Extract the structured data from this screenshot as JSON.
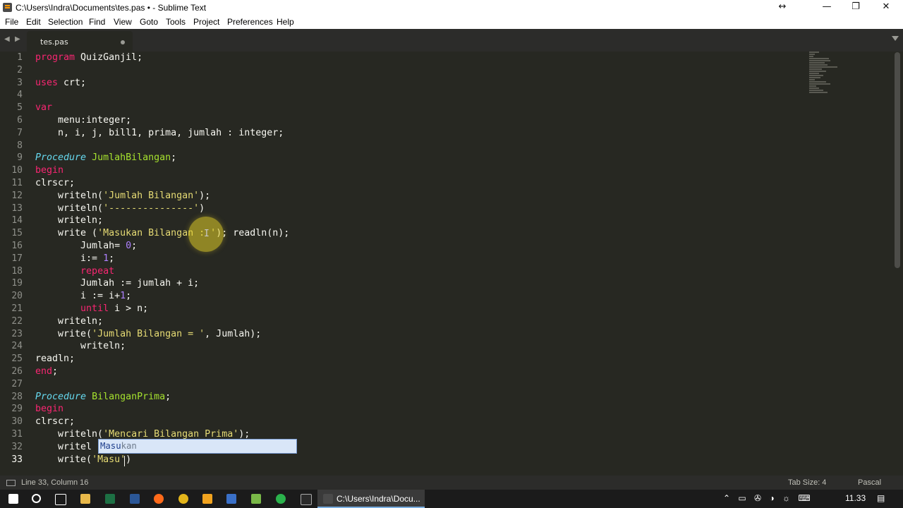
{
  "window": {
    "title": "C:\\Users\\Indra\\Documents\\tes.pas • - Sublime Text",
    "controls": {
      "resize": "↔",
      "minimize": "—",
      "restore": "❐",
      "close": "✕"
    }
  },
  "menu": [
    "File",
    "Edit",
    "Selection",
    "Find",
    "View",
    "Goto",
    "Tools",
    "Project",
    "Preferences",
    "Help"
  ],
  "tabs": [
    {
      "label": "tes.pas",
      "dirty": true
    }
  ],
  "editor": {
    "line_numbers": [
      "1",
      "2",
      "3",
      "4",
      "5",
      "6",
      "7",
      "8",
      "9",
      "10",
      "11",
      "12",
      "13",
      "14",
      "15",
      "16",
      "17",
      "18",
      "19",
      "20",
      "21",
      "22",
      "23",
      "24",
      "25",
      "26",
      "27",
      "28",
      "29",
      "30",
      "31",
      "32",
      "33"
    ],
    "current_line": "33",
    "code": {
      "l1_kw": "program",
      "l1_rest": " QuizGanjil;",
      "l3_kw": "uses",
      "l3_rest": " crt;",
      "l5_kw": "var",
      "l6": "    menu:integer;",
      "l7": "    n, i, j, bill1, prima, jumlah : integer;",
      "l9_kw": "Procedure",
      "l9_name": "JumlahBilangan",
      "l9_end": ";",
      "l10_kw": "begin",
      "l11": "clrscr;",
      "l12_a": "    writeln(",
      "l12_s": "'Jumlah Bilangan'",
      "l12_b": ");",
      "l13_a": "    writeln(",
      "l13_s": "'---------------'",
      "l13_b": ")",
      "l14": "    writeln;",
      "l15_a": "    write (",
      "l15_s": "'Masukan Bilangan : '",
      "l15_b": "); readln(n);",
      "l16_a": "        Jumlah= ",
      "l16_n": "0",
      "l16_b": ";",
      "l17_a": "        i:= ",
      "l17_n": "1",
      "l17_b": ";",
      "l18_kw": "repeat",
      "l19": "        Jumlah := jumlah + i;",
      "l20_a": "        i := i+",
      "l20_n": "1",
      "l20_b": ";",
      "l21_kw": "until",
      "l21_rest": " i > n;",
      "l22": "    writeln;",
      "l23_a": "    write(",
      "l23_s": "'Jumlah Bilangan = '",
      "l23_b": ", Jumlah);",
      "l24": "        writeln;",
      "l25": "readln;",
      "l26_kw": "end",
      "l26_rest": ";",
      "l28_kw": "Procedure",
      "l28_name": "BilanganPrima",
      "l28_end": ";",
      "l29_kw": "begin",
      "l30": "clrscr;",
      "l31_a": "    writeln(",
      "l31_s": "'Mencari Bilangan Prima'",
      "l31_b": ");",
      "l32": "    writel",
      "l33_a": "    write(",
      "l33_s": "'Masu'",
      "l33_b": ")"
    },
    "autocomplete": {
      "match": "Masu",
      "rest": "kan"
    }
  },
  "status": {
    "position": "Line 33, Column 16",
    "tab_size": "Tab Size: 4",
    "syntax": "Pascal"
  },
  "taskbar": {
    "active_window": "C:\\Users\\Indra\\Docu...",
    "time": "11.33",
    "tray_glyphs": "⌃  ▭  ✇  ◑  ☼  ⌨"
  },
  "colors": {
    "background": "#272822",
    "keyword": "#f92672",
    "function": "#a6e22e",
    "string": "#e6db74",
    "number": "#ae81ff",
    "storage": "#66d9ef"
  }
}
